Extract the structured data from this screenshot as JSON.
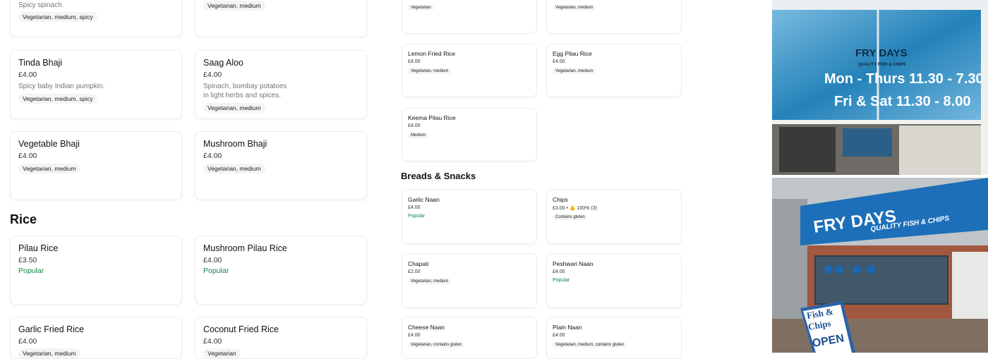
{
  "left": {
    "top_items": [
      {
        "desc": "Spicy spinach.",
        "tag": "Vegetarian, medium, spicy"
      },
      {
        "tag": "Vegetarian, medium"
      }
    ],
    "items": [
      {
        "name": "Tinda Bhaji",
        "price": "£4.00",
        "desc": "Spicy baby Indian pumpkin.",
        "tag": "Vegetarian, medium, spicy"
      },
      {
        "name": "Saag Aloo",
        "price": "£4.00",
        "desc1": "Spinach, bombay potatoes",
        "desc2": "in light herbs and spices.",
        "tag": "Vegetarian, medium"
      },
      {
        "name": "Vegetable Bhaji",
        "price": "£4.00",
        "tag": "Vegetarian, medium"
      },
      {
        "name": "Mushroom Bhaji",
        "price": "£4.00",
        "tag": "Vegetarian, medium"
      }
    ],
    "rice_title": "Rice",
    "rice_items": [
      {
        "name": "Pilau Rice",
        "price": "£3.50",
        "popular": "Popular"
      },
      {
        "name": "Mushroom Pilau Rice",
        "price": "£4.00",
        "popular": "Popular"
      },
      {
        "name": "Garlic Fried Rice",
        "price": "£4.00",
        "tag": "Vegetarian, medium"
      },
      {
        "name": "Coconut Fried Rice",
        "price": "£4.00",
        "tag": "Vegetarian"
      }
    ]
  },
  "middle": {
    "top_tags": [
      "Vegetarian",
      "Vegetarian, medium"
    ],
    "rice_items": [
      {
        "name": "Lemon Fried Rice",
        "price": "£4.00",
        "tag": "Vegetarian, medium"
      },
      {
        "name": "Egg Pilau Rice",
        "price": "£4.00",
        "tag": "Vegetarian, medium"
      },
      {
        "name": "Keema Pilau Rice",
        "price": "£4.00",
        "tag": "Medium"
      }
    ],
    "breads_title": "Breads & Snacks",
    "breads": [
      {
        "name": "Garlic Naan",
        "price": "£4.00",
        "popular": "Popular"
      },
      {
        "name": "Chips",
        "price": "£3.00 • 👍 100% (3)",
        "tag": "Contains gluten"
      },
      {
        "name": "Chapati",
        "price": "£2.00",
        "tag": "Vegetarian, medium"
      },
      {
        "name": "Peshwari Naan",
        "price": "£4.00",
        "popular": "Popular"
      },
      {
        "name": "Cheese Naan",
        "price": "£4.00",
        "tag": "Vegetarian, contains gluten"
      },
      {
        "name": "Plain Naan",
        "price": "£4.00",
        "tag": "Vegetarian, medium, contains gluten"
      }
    ]
  },
  "photos": {
    "top": {
      "sign_brand": "FRY DAYS",
      "sign_sub": "QUALITY FISH & CHIPS",
      "hours1": "Mon - Thurs 11.30 - 7.30",
      "hours2": "Fri & Sat 11.30 - 8.00"
    },
    "bottom": {
      "sign_brand": "FRY DAYS",
      "sign_sub": "QUALITY FISH & CHIPS",
      "board1": "Fish &",
      "board2": "Chips",
      "board3": "OPEN"
    }
  }
}
